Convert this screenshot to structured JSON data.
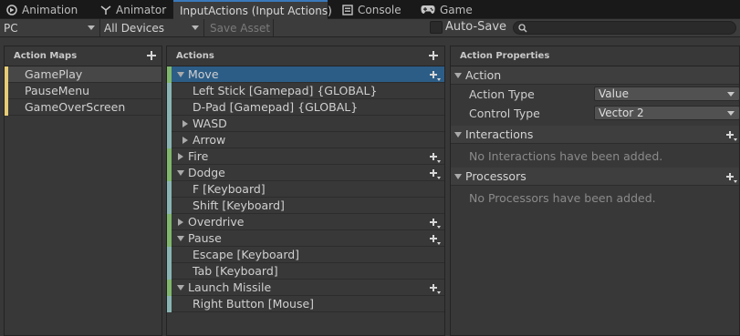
{
  "tabs": [
    {
      "label": "Animation",
      "icon": "animation-icon"
    },
    {
      "label": "Animator",
      "icon": "animator-icon"
    },
    {
      "label": "InputActions (Input Actions)",
      "icon": "input-actions-icon",
      "active": true
    },
    {
      "label": "Console",
      "icon": "console-icon"
    },
    {
      "label": "Game",
      "icon": "gamepad-icon"
    }
  ],
  "toolbar": {
    "control_scheme": "PC",
    "devices": "All Devices",
    "save_asset": "Save Asset",
    "auto_save_label": "Auto-Save",
    "auto_save_checked": false,
    "search_placeholder": ""
  },
  "action_maps": {
    "header": "Action Maps",
    "items": [
      {
        "label": "GamePlay",
        "selected": true
      },
      {
        "label": "PauseMenu"
      },
      {
        "label": "GameOverScreen"
      }
    ]
  },
  "actions": {
    "header": "Actions",
    "rows": [
      {
        "label": "Move",
        "kind": "action",
        "expanded": true,
        "selected": true
      },
      {
        "label": "Left Stick [Gamepad] {GLOBAL}",
        "kind": "binding"
      },
      {
        "label": "D-Pad [Gamepad] {GLOBAL}",
        "kind": "binding"
      },
      {
        "label": "WASD",
        "kind": "composite",
        "expanded": false
      },
      {
        "label": "Arrow",
        "kind": "composite",
        "expanded": false
      },
      {
        "label": "Fire",
        "kind": "action",
        "expanded": false
      },
      {
        "label": "Dodge",
        "kind": "action",
        "expanded": true
      },
      {
        "label": "F [Keyboard]",
        "kind": "binding"
      },
      {
        "label": "Shift [Keyboard]",
        "kind": "binding"
      },
      {
        "label": "Overdrive",
        "kind": "action",
        "expanded": false
      },
      {
        "label": "Pause",
        "kind": "action",
        "expanded": true
      },
      {
        "label": "Escape [Keyboard]",
        "kind": "binding"
      },
      {
        "label": "Tab [Keyboard]",
        "kind": "binding"
      },
      {
        "label": "Launch Missile",
        "kind": "action",
        "expanded": true
      },
      {
        "label": "Right Button [Mouse]",
        "kind": "binding"
      }
    ]
  },
  "properties": {
    "header": "Action Properties",
    "action_section": "Action",
    "action_type_label": "Action Type",
    "action_type_value": "Value",
    "control_type_label": "Control Type",
    "control_type_value": "Vector 2",
    "interactions_section": "Interactions",
    "interactions_empty": "No Interactions have been added.",
    "processors_section": "Processors",
    "processors_empty": "No Processors have been added."
  },
  "colors": {
    "action_map_bar": "#e6cd75",
    "action_bar": "#7fb86b",
    "binding_bar": "#8ab4b4",
    "selection": "#2c5d87",
    "active_tab_accent": "#3a79bb"
  }
}
